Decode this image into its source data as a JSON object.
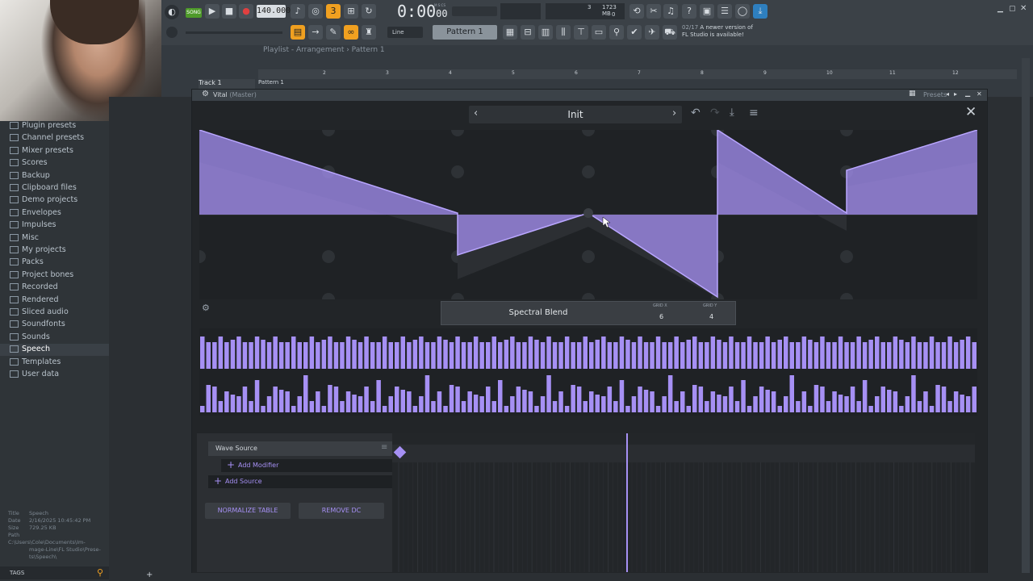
{
  "toolbar": {
    "song_mode": "SONG",
    "tempo": "140.000",
    "time": "0:00",
    "time_frac": "00",
    "time_unit": "M:S:CS",
    "memory": "1723 MB",
    "cpu_polyphony": "3",
    "cpu_value": "0",
    "pattern_label": "Pattern 1",
    "line_label": "Line",
    "news_date": "02/17",
    "news_text": "A newer version of",
    "news_text2": "FL Studio is available!",
    "brand_color": "#f0a020"
  },
  "playlist": {
    "breadcrumb": "Playlist - Arrangement › Pattern 1",
    "track_name": "Track 1",
    "pattern_clip": "Pattern 1",
    "ruler": [
      "2",
      "3",
      "4",
      "5",
      "6",
      "7",
      "8",
      "9",
      "10",
      "11",
      "12"
    ]
  },
  "browser": {
    "items": [
      {
        "label": "Plugin presets",
        "icon": "plugin-icon"
      },
      {
        "label": "Channel presets",
        "icon": "folder-icon"
      },
      {
        "label": "Mixer presets",
        "icon": "folder-icon"
      },
      {
        "label": "Scores",
        "icon": "score-icon"
      },
      {
        "label": "Backup",
        "icon": "backup-icon"
      },
      {
        "label": "Clipboard files",
        "icon": "folder-icon"
      },
      {
        "label": "Demo projects",
        "icon": "folder-icon"
      },
      {
        "label": "Envelopes",
        "icon": "folder-icon"
      },
      {
        "label": "Impulses",
        "icon": "folder-icon"
      },
      {
        "label": "Misc",
        "icon": "folder-icon"
      },
      {
        "label": "My projects",
        "icon": "folder-icon"
      },
      {
        "label": "Packs",
        "icon": "folder-icon"
      },
      {
        "label": "Project bones",
        "icon": "folder-icon"
      },
      {
        "label": "Recorded",
        "icon": "recorded-icon"
      },
      {
        "label": "Rendered",
        "icon": "rendered-icon"
      },
      {
        "label": "Sliced audio",
        "icon": "folder-icon"
      },
      {
        "label": "Soundfonts",
        "icon": "folder-icon"
      },
      {
        "label": "Sounds",
        "icon": "cloud-icon"
      },
      {
        "label": "Speech",
        "icon": "speech-icon"
      },
      {
        "label": "Templates",
        "icon": "folder-icon"
      },
      {
        "label": "User data",
        "icon": "user-icon"
      }
    ],
    "info": {
      "title_key": "Title",
      "title_val": "Speech",
      "date_key": "Date",
      "date_val": "2/16/2025 10:45:42 PM",
      "size_key": "Size",
      "size_val": "729.25 KB",
      "path_key": "Path",
      "path_val": "C:\\Users\\Cole\\Documents\\Im-",
      "path_val2": "mage-Line\\FL Studio\\Prese-",
      "path_val3": "ts\\Speech\\"
    },
    "tags_label": "TAGS"
  },
  "vital": {
    "window_title": "Vital",
    "window_sub": "(Master)",
    "presets_label": "Presets",
    "preset_name": "Init",
    "panel_title": "Spectral Blend",
    "grid_x_label": "GRID X",
    "grid_x_value": "6",
    "grid_y_label": "GRID Y",
    "grid_y_value": "4",
    "wave_source_label": "Wave Source",
    "add_modifier_label": "Add Modifier",
    "add_source_label": "Add Source",
    "normalize_label": "NORMALIZE TABLE",
    "remove_dc_label": "REMOVE DC",
    "accent_color": "#a690f4",
    "background_color": "#222528"
  }
}
